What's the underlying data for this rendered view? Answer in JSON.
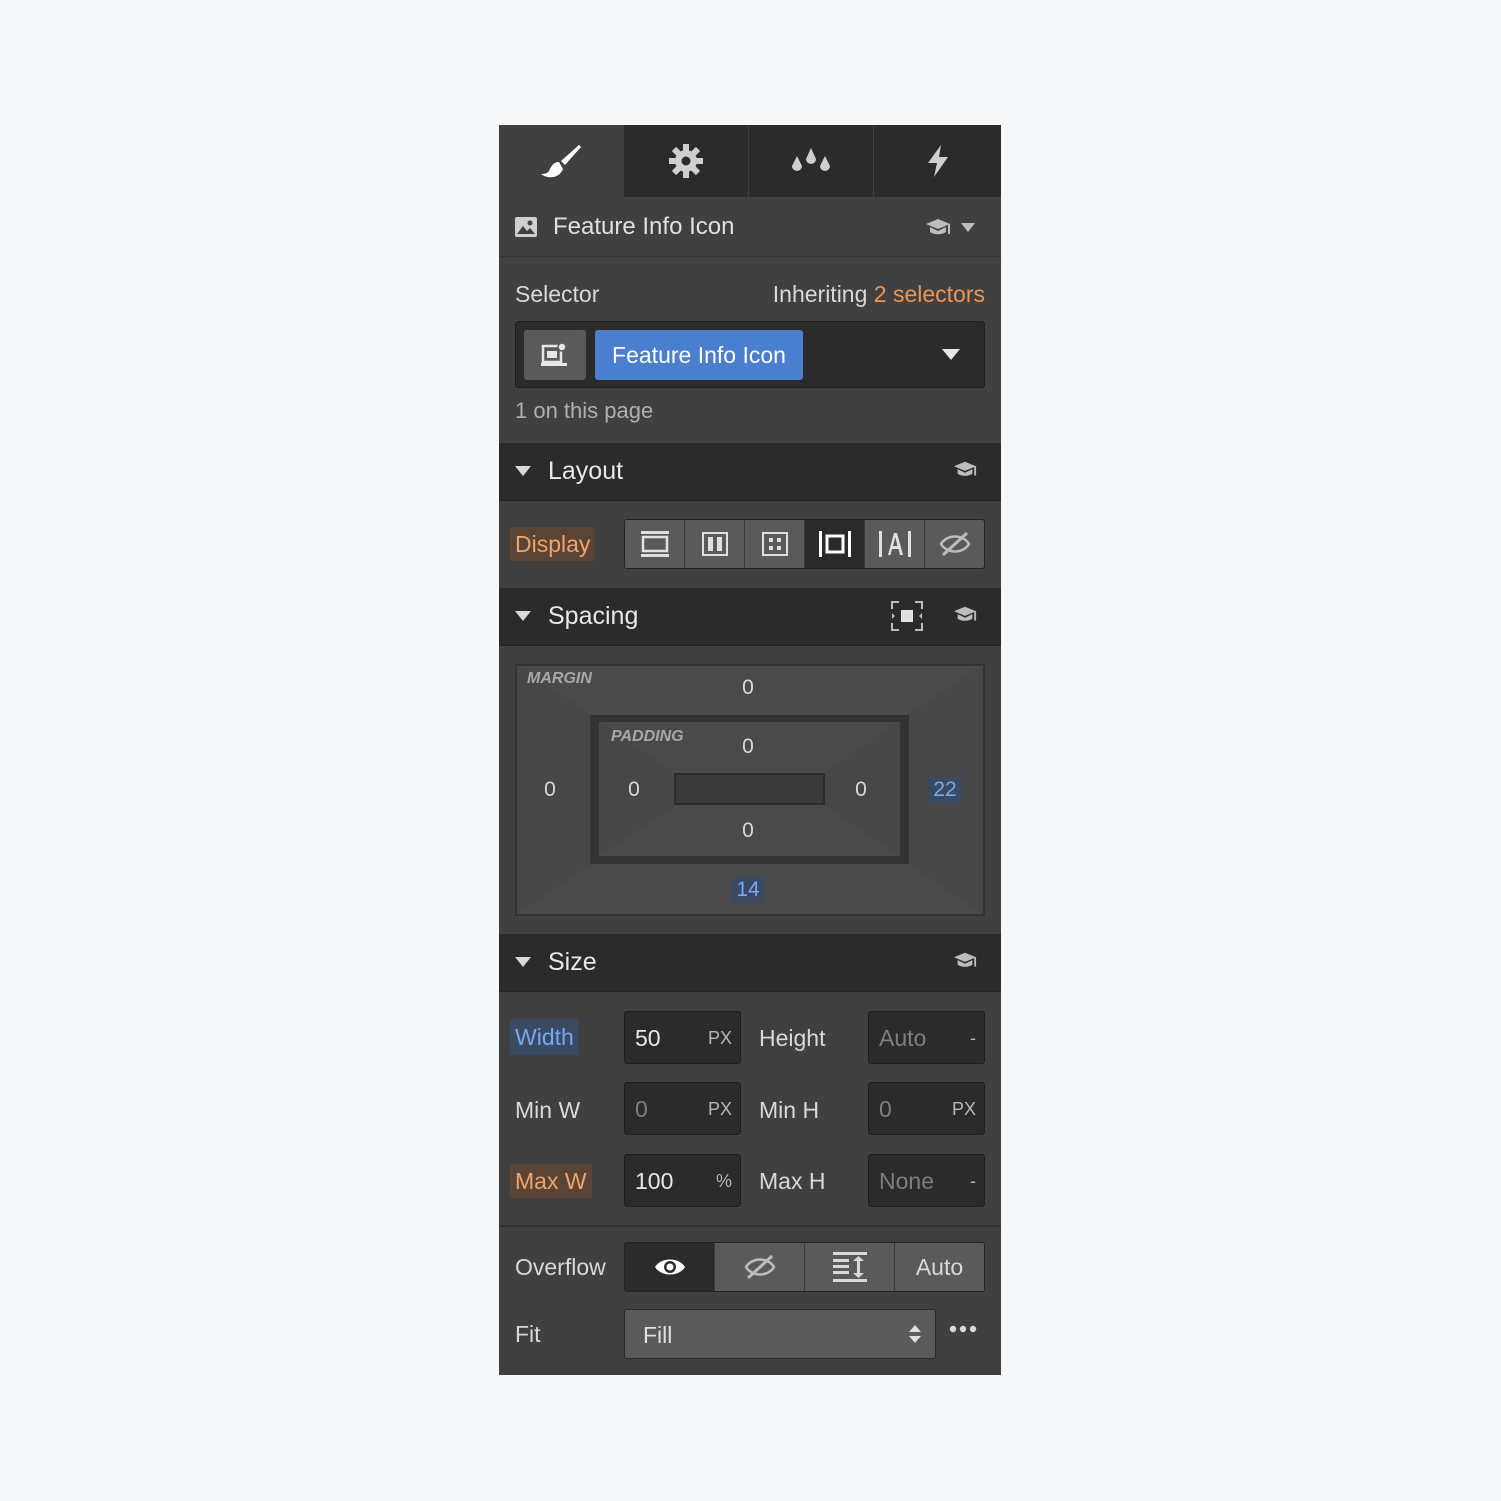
{
  "tabs": [
    {
      "icon": "paintbrush-icon",
      "active": true
    },
    {
      "icon": "gear-icon",
      "active": false
    },
    {
      "icon": "droplets-icon",
      "active": false
    },
    {
      "icon": "lightning-icon",
      "active": false
    }
  ],
  "element": {
    "icon": "image-icon",
    "name": "Feature Info Icon"
  },
  "selector": {
    "label": "Selector",
    "inheriting_prefix": "Inheriting",
    "inheriting_link": "2 selectors",
    "chip": "Feature Info Icon",
    "count_text": "1 on this page"
  },
  "layout": {
    "title": "Layout",
    "display_label": "Display",
    "display_options": [
      "block",
      "flex",
      "grid",
      "inline-block",
      "inline",
      "none"
    ],
    "active_option": "inline-block"
  },
  "spacing": {
    "title": "Spacing",
    "margin_label": "MARGIN",
    "padding_label": "PADDING",
    "margin": {
      "top": "0",
      "left": "0",
      "right": "22",
      "bottom": "14"
    },
    "padding": {
      "top": "0",
      "left": "0",
      "right": "0",
      "bottom": "0"
    }
  },
  "size": {
    "title": "Size",
    "width": {
      "label": "Width",
      "value": "50",
      "unit": "PX"
    },
    "height": {
      "label": "Height",
      "value": "Auto",
      "unit": "-"
    },
    "min_w": {
      "label": "Min W",
      "value": "0",
      "unit": "PX"
    },
    "min_h": {
      "label": "Min H",
      "value": "0",
      "unit": "PX"
    },
    "max_w": {
      "label": "Max W",
      "value": "100",
      "unit": "%"
    },
    "max_h": {
      "label": "Max H",
      "value": "None",
      "unit": "-"
    },
    "overflow_label": "Overflow",
    "overflow_auto": "Auto",
    "fit_label": "Fit",
    "fit_value": "Fill"
  },
  "colors": {
    "accent_orange": "#f0944e",
    "accent_blue": "#4a7fcf",
    "panel_bg": "#404040",
    "header_bg": "#2b2b2b"
  }
}
